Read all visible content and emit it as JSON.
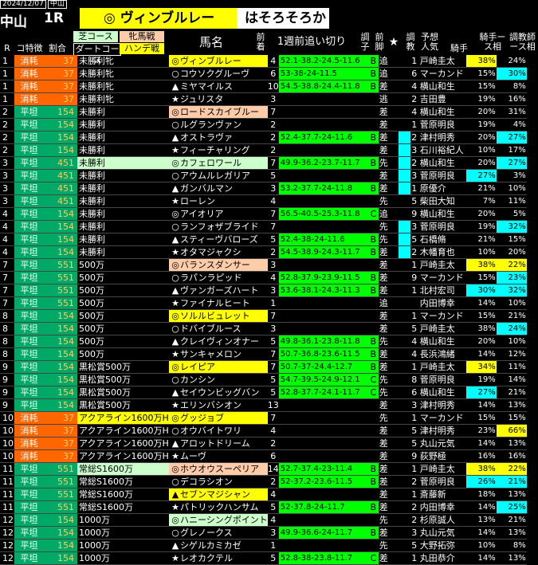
{
  "header": {
    "date": "2024/12/07",
    "venue_small": "中山",
    "venue": "中山",
    "race": "1R",
    "pick_mark": "◎",
    "pick_name": "ヴィンブルレー",
    "comment": "はそろそろか"
  },
  "columns": {
    "r": "R",
    "koku": "コ特徴",
    "wari": "割合",
    "cond_top": "芝コース",
    "cond_bottom": "ダートコース",
    "sexage": "牝馬戦",
    "handicap": "ハンデ戦",
    "horse": "馬名",
    "popularity": "前着",
    "training": "1週前追い切り",
    "grade": "調子",
    "leg": "前脚",
    "star": "★",
    "trainer_rank": "調教",
    "ninki": "予想人気",
    "jockey": "騎手",
    "jockey_rate": "騎手ース相",
    "trainer_rate": "調教師ース相"
  },
  "colors": {
    "shouhi": "#ff6600",
    "heitan": "#00aa66",
    "cond_green": "#ccffcc",
    "pick_pink": "#ffccaa",
    "yellow": "#ffff00",
    "cyan": "#00ffff",
    "pos_green": "#00ff00"
  },
  "rows": [
    {
      "r": "1",
      "k": "消耗",
      "w": "37",
      "c": "未勝利牝",
      "cc": "",
      "m": "◎",
      "h": "ヴィンブルレー",
      "hc": "yellow",
      "p": "4",
      "t": "52.1-38.2-24.5-11.6",
      "g": "B",
      "l": "追",
      "s": "",
      "tk": "",
      "n": "1",
      "j": "戸崎圭太",
      "j1": "38%",
      "j1c": "yellow",
      "j2": "24%",
      "j2c": ""
    },
    {
      "r": "1",
      "k": "消耗",
      "w": "37",
      "c": "未勝利牝",
      "cc": "",
      "m": "○",
      "h": "コウソクグルーヴ",
      "hc": "",
      "p": "6",
      "t": "53-38-24-11.5",
      "g": "B",
      "l": "追",
      "s": "",
      "tk": "",
      "n": "6",
      "j": "マーカンド",
      "j1": "15%",
      "j1c": "",
      "j2": "30%",
      "j2c": "cyan"
    },
    {
      "r": "1",
      "k": "消耗",
      "w": "37",
      "c": "未勝利牝",
      "cc": "",
      "m": "▲",
      "h": "ミヤマイルス",
      "hc": "",
      "p": "10",
      "t": "54.5-38.8-24.4-11.8",
      "g": "B",
      "l": "差",
      "s": "",
      "tk": "",
      "n": "4",
      "j": "横山和生",
      "j1": "15%",
      "j1c": "",
      "j2": "8%",
      "j2c": ""
    },
    {
      "r": "1",
      "k": "消耗",
      "w": "37",
      "c": "未勝利牝",
      "cc": "",
      "m": "★",
      "h": "ジュリスタ",
      "hc": "",
      "p": "3",
      "t": "",
      "g": "",
      "l": "逃",
      "s": "",
      "tk": "",
      "n": "2",
      "j": "吉田豊",
      "j1": "19%",
      "j1c": "",
      "j2": "16%",
      "j2c": ""
    },
    {
      "r": "2",
      "k": "平坦",
      "w": "154",
      "c": "未勝利",
      "cc": "",
      "m": "◎",
      "h": "ロードスカイブルー",
      "hc": "pink",
      "p": "7",
      "t": "",
      "g": "",
      "l": "差",
      "s": "",
      "tk": "",
      "n": "4",
      "j": "横山和生",
      "j1": "20%",
      "j1c": "",
      "j2": "31%",
      "j2c": ""
    },
    {
      "r": "2",
      "k": "平坦",
      "w": "154",
      "c": "未勝利",
      "cc": "",
      "m": "○",
      "h": "ルグランヴァン",
      "hc": "",
      "p": "2",
      "t": "",
      "g": "",
      "l": "差",
      "s": "",
      "tk": "",
      "n": "1",
      "j": "菅原明良",
      "j1": "19%",
      "j1c": "",
      "j2": "4%",
      "j2c": ""
    },
    {
      "r": "2",
      "k": "平坦",
      "w": "154",
      "c": "未勝利",
      "cc": "",
      "m": "▲",
      "h": "オストラヴァ",
      "hc": "",
      "p": "2",
      "t": "52.4-37.7-24-11.6",
      "g": "B",
      "l": "差",
      "s": "",
      "tk": "c",
      "n": "2",
      "j": "津村明秀",
      "j1": "20%",
      "j1c": "",
      "j2": "27%",
      "j2c": "cyan"
    },
    {
      "r": "2",
      "k": "平坦",
      "w": "154",
      "c": "未勝利",
      "cc": "",
      "m": "★",
      "h": "フィーチャリング",
      "hc": "",
      "p": "2",
      "t": "",
      "g": "",
      "l": "差",
      "s": "",
      "tk": "c",
      "n": "3",
      "j": "石川裕紀人",
      "j1": "10%",
      "j1c": "",
      "j2": "17%",
      "j2c": ""
    },
    {
      "r": "3",
      "k": "平坦",
      "w": "451",
      "c": "未勝利",
      "cc": "green",
      "m": "◎",
      "h": "カフェロワール",
      "hc": "green",
      "p": "7",
      "t": "49.9-36.2-23.7-11.7",
      "g": "B",
      "l": "先",
      "s": "",
      "tk": "c",
      "n": "2",
      "j": "横山和生",
      "j1": "20%",
      "j1c": "",
      "j2": "27%",
      "j2c": "cyan"
    },
    {
      "r": "3",
      "k": "平坦",
      "w": "451",
      "c": "未勝利",
      "cc": "",
      "m": "○",
      "h": "アウムルレガリア",
      "hc": "",
      "p": "5",
      "t": "",
      "g": "",
      "l": "差",
      "s": "",
      "tk": "c",
      "n": "3",
      "j": "菅原明良",
      "j1": "27%",
      "j1c": "cyan",
      "j2": "3%",
      "j2c": ""
    },
    {
      "r": "3",
      "k": "平坦",
      "w": "451",
      "c": "未勝利",
      "cc": "",
      "m": "▲",
      "h": "ガンバルマン",
      "hc": "",
      "p": "3",
      "t": "53.2-37.7-24-11.8",
      "g": "B",
      "l": "差",
      "s": "",
      "tk": "c",
      "n": "1",
      "j": "原優介",
      "j1": "21%",
      "j1c": "",
      "j2": "10%",
      "j2c": ""
    },
    {
      "r": "3",
      "k": "平坦",
      "w": "451",
      "c": "未勝利",
      "cc": "",
      "m": "★",
      "h": "ローレン",
      "hc": "",
      "p": "4",
      "t": "",
      "g": "",
      "l": "先",
      "s": "",
      "tk": "",
      "n": "5",
      "j": "柴田大知",
      "j1": "7%",
      "j1c": "",
      "j2": "11%",
      "j2c": ""
    },
    {
      "r": "4",
      "k": "平坦",
      "w": "154",
      "c": "未勝利",
      "cc": "",
      "m": "◎",
      "h": "アイオリア",
      "hc": "",
      "p": "7",
      "t": "56.5-40.5-25.3-11.8",
      "g": "C",
      "l": "追",
      "s": "",
      "tk": "",
      "n": "9",
      "j": "横山和生",
      "j1": "20%",
      "j1c": "",
      "j2": "5%",
      "j2c": ""
    },
    {
      "r": "4",
      "k": "平坦",
      "w": "154",
      "c": "未勝利",
      "cc": "",
      "m": "○",
      "h": "ランフォザブライド",
      "hc": "",
      "p": "7",
      "t": "",
      "g": "",
      "l": "先",
      "s": "",
      "tk": "c",
      "n": "3",
      "j": "菅原明良",
      "j1": "19%",
      "j1c": "",
      "j2": "32%",
      "j2c": "cyan"
    },
    {
      "r": "4",
      "k": "平坦",
      "w": "154",
      "c": "未勝利",
      "cc": "",
      "m": "▲",
      "h": "スティーヴバローズ",
      "hc": "",
      "p": "5",
      "t": "52.4-38-24-11.6",
      "g": "B",
      "l": "先",
      "s": "",
      "tk": "c",
      "n": "5",
      "j": "石橋脩",
      "j1": "21%",
      "j1c": "",
      "j2": "15%",
      "j2c": ""
    },
    {
      "r": "4",
      "k": "平坦",
      "w": "154",
      "c": "未勝利",
      "cc": "",
      "m": "★",
      "h": "オタマジャクシ",
      "hc": "",
      "p": "2",
      "t": "54.5-38.9-24.3-11.7",
      "g": "B",
      "l": "差",
      "s": "",
      "tk": "c",
      "n": "2",
      "j": "木幡育也",
      "j1": "10%",
      "j1c": "",
      "j2": "20%",
      "j2c": ""
    },
    {
      "r": "7",
      "k": "平坦",
      "w": "551",
      "c": "500万",
      "cc": "",
      "m": "◎",
      "h": "バランスダンサー",
      "hc": "pink",
      "p": "3",
      "t": "",
      "g": "",
      "l": "差",
      "s": "",
      "tk": "",
      "n": "1",
      "j": "戸崎圭太",
      "j1": "38%",
      "j1c": "yellow",
      "j2": "22%",
      "j2c": "yellow"
    },
    {
      "r": "7",
      "k": "平坦",
      "w": "551",
      "c": "500万",
      "cc": "",
      "m": "○",
      "h": "ラパンラピッド",
      "hc": "",
      "p": "4",
      "t": "52.8-37.9-23.9-11.5",
      "g": "B",
      "l": "差",
      "s": "",
      "tk": "",
      "n": "9",
      "j": "マーカンド",
      "j1": "15%",
      "j1c": "",
      "j2": "23%",
      "j2c": "cyan"
    },
    {
      "r": "7",
      "k": "平坦",
      "w": "551",
      "c": "500万",
      "cc": "",
      "m": "▲",
      "h": "ヴァンガーズハート",
      "hc": "",
      "p": "3",
      "t": "53.6-38.1-24.3-11.3",
      "g": "B",
      "l": "差",
      "s": "",
      "tk": "",
      "n": "1",
      "j": "北村宏司",
      "j1": "30%",
      "j1c": "cyan",
      "j2": "32%",
      "j2c": "cyan"
    },
    {
      "r": "7",
      "k": "平坦",
      "w": "551",
      "c": "500万",
      "cc": "",
      "m": "★",
      "h": "ファイナルヒート",
      "hc": "",
      "p": "1",
      "t": "",
      "g": "",
      "l": "追",
      "s": "",
      "tk": "",
      "n": "",
      "j": "内田博幸",
      "j1": "14%",
      "j1c": "",
      "j2": "10%",
      "j2c": ""
    },
    {
      "r": "8",
      "k": "平坦",
      "w": "154",
      "c": "500万",
      "cc": "",
      "m": "◎",
      "h": "ソルルビュレット",
      "hc": "yellow",
      "p": "7",
      "t": "",
      "g": "",
      "l": "差",
      "s": "",
      "tk": "",
      "n": "1",
      "j": "マーカンド",
      "j1": "15%",
      "j1c": "",
      "j2": "21%",
      "j2c": ""
    },
    {
      "r": "8",
      "k": "平坦",
      "w": "154",
      "c": "500万",
      "cc": "",
      "m": "○",
      "h": "ドバイブルース",
      "hc": "",
      "p": "3",
      "t": "",
      "g": "",
      "l": "差",
      "s": "",
      "tk": "",
      "n": "5",
      "j": "戸崎圭太",
      "j1": "38%",
      "j1c": "",
      "j2": "24%",
      "j2c": "cyan"
    },
    {
      "r": "8",
      "k": "平坦",
      "w": "154",
      "c": "500万",
      "cc": "",
      "m": "▲",
      "h": "クレイヴィンオナー",
      "hc": "",
      "p": "5",
      "t": "49.8-36.1-23.8-11.8",
      "g": "B",
      "l": "先",
      "s": "",
      "tk": "",
      "n": "4",
      "j": "横山和生",
      "j1": "20%",
      "j1c": "",
      "j2": "10%",
      "j2c": ""
    },
    {
      "r": "8",
      "k": "平坦",
      "w": "154",
      "c": "500万",
      "cc": "",
      "m": "★",
      "h": "サンキャメロン",
      "hc": "",
      "p": "7",
      "t": "50.7-36.8-23.6-11.5",
      "g": "B",
      "l": "差",
      "s": "",
      "tk": "",
      "n": "4",
      "j": "長浜鴻緒",
      "j1": "14%",
      "j1c": "",
      "j2": "12%",
      "j2c": ""
    },
    {
      "r": "9",
      "k": "平坦",
      "w": "154",
      "c": "黒松賞500万",
      "cc": "",
      "m": "◎",
      "h": "レイピア",
      "hc": "yellow",
      "p": "7",
      "t": "50.7-37-24.4-12.7",
      "g": "B",
      "l": "差",
      "s": "",
      "tk": "",
      "n": "1",
      "j": "戸崎圭太",
      "j1": "34%",
      "j1c": "yellow",
      "j2": "11%",
      "j2c": ""
    },
    {
      "r": "9",
      "k": "平坦",
      "w": "154",
      "c": "黒松賞500万",
      "cc": "",
      "m": "○",
      "h": "カンシン",
      "hc": "",
      "p": "5",
      "t": "54.7-39.5-24.9-12.1",
      "g": "C",
      "l": "先",
      "s": "",
      "tk": "",
      "n": "8",
      "j": "菅原明良",
      "j1": "19%",
      "j1c": "",
      "j2": "14%",
      "j2c": ""
    },
    {
      "r": "9",
      "k": "平坦",
      "w": "154",
      "c": "黒松賞500万",
      "cc": "",
      "m": "▲",
      "h": "セイウンビッグバン",
      "hc": "",
      "p": "5",
      "t": "52.8-37.7-24.1-11.7",
      "g": "C",
      "l": "先",
      "s": "",
      "tk": "",
      "n": "6",
      "j": "横山和生",
      "j1": "27%",
      "j1c": "cyan",
      "j2": "21%",
      "j2c": ""
    },
    {
      "r": "9",
      "k": "平坦",
      "w": "154",
      "c": "黒松賞500万",
      "cc": "",
      "m": "★",
      "h": "エリンバシオン",
      "hc": "",
      "p": "13",
      "t": "",
      "g": "",
      "l": "差",
      "s": "",
      "tk": "",
      "n": "3",
      "j": "津村明秀",
      "j1": "14%",
      "j1c": "",
      "j2": "13%",
      "j2c": ""
    },
    {
      "r": "10",
      "k": "消耗",
      "w": "37",
      "c": "アクアライン1600万H",
      "cc": "yellow",
      "m": "◎",
      "h": "グッジョブ",
      "hc": "yellow",
      "p": "7",
      "t": "",
      "g": "",
      "l": "先",
      "s": "",
      "tk": "",
      "n": "1",
      "j": "マーカンド",
      "j1": "15%",
      "j1c": "",
      "j2": "15%",
      "j2c": ""
    },
    {
      "r": "10",
      "k": "消耗",
      "w": "37",
      "c": "アクアライン1600万H",
      "cc": "",
      "m": "○",
      "h": "オウバイトワリ",
      "hc": "",
      "p": "4",
      "t": "",
      "g": "",
      "l": "差",
      "s": "",
      "tk": "",
      "n": "5",
      "j": "津村明秀",
      "j1": "23%",
      "j1c": "",
      "j2": "66%",
      "j2c": "yellow"
    },
    {
      "r": "10",
      "k": "消耗",
      "w": "37",
      "c": "アクアライン1600万H",
      "cc": "",
      "m": "▲",
      "h": "アロットドリーム",
      "hc": "",
      "p": "2",
      "t": "",
      "g": "",
      "l": "差",
      "s": "",
      "tk": "",
      "n": "5",
      "j": "丸山元気",
      "j1": "14%",
      "j1c": "",
      "j2": "13%",
      "j2c": ""
    },
    {
      "r": "10",
      "k": "消耗",
      "w": "37",
      "c": "アクアライン1600万H",
      "cc": "",
      "m": "★",
      "h": "ムーヴ",
      "hc": "",
      "p": "6",
      "t": "",
      "g": "",
      "l": "差",
      "s": "",
      "tk": "",
      "n": "9",
      "j": "荻野極",
      "j1": "16%",
      "j1c": "",
      "j2": "16%",
      "j2c": ""
    },
    {
      "r": "11",
      "k": "平坦",
      "w": "551",
      "c": "常総S1600万",
      "cc": "green",
      "m": "◎",
      "h": "ホウオウスーペリア",
      "hc": "pink",
      "p": "14",
      "t": "52.7-37.4-23-11.4",
      "g": "B",
      "l": "差",
      "s": "",
      "tk": "",
      "n": "1",
      "j": "戸崎圭太",
      "j1": "38%",
      "j1c": "yellow",
      "j2": "22%",
      "j2c": "yellow"
    },
    {
      "r": "11",
      "k": "平坦",
      "w": "551",
      "c": "常総S1600万",
      "cc": "",
      "m": "○",
      "h": "デコラシオン",
      "hc": "",
      "p": "2",
      "t": "52-37.2-23.6-11.5",
      "g": "B",
      "l": "差",
      "s": "",
      "tk": "",
      "n": "2",
      "j": "菅原明良",
      "j1": "26%",
      "j1c": "cyan",
      "j2": "21%",
      "j2c": "cyan"
    },
    {
      "r": "11",
      "k": "平坦",
      "w": "551",
      "c": "常総S1600万",
      "cc": "",
      "m": "▲",
      "h": "セブンマジシャン",
      "hc": "yellow",
      "p": "4",
      "t": "",
      "g": "",
      "l": "差",
      "s": "",
      "tk": "",
      "n": "1",
      "j": "斎藤新",
      "j1": "18%",
      "j1c": "",
      "j2": "13%",
      "j2c": ""
    },
    {
      "r": "11",
      "k": "平坦",
      "w": "551",
      "c": "常総S1600万",
      "cc": "",
      "m": "★",
      "h": "パトリックハンサム",
      "hc": "",
      "p": "5",
      "t": "52-37.8-24-11.7",
      "g": "B",
      "l": "差",
      "s": "",
      "tk": "",
      "n": "2",
      "j": "内田博幸",
      "j1": "14%",
      "j1c": "",
      "j2": "25%",
      "j2c": "cyan"
    },
    {
      "r": "12",
      "k": "平坦",
      "w": "154",
      "c": "1000万",
      "cc": "",
      "m": "◎",
      "h": "ハニーシングポイント",
      "hc": "green",
      "p": "4",
      "t": "",
      "g": "",
      "l": "先",
      "s": "",
      "tk": "",
      "n": "2",
      "j": "杉原誠人",
      "j1": "13%",
      "j1c": "",
      "j2": "21%",
      "j2c": ""
    },
    {
      "r": "12",
      "k": "平坦",
      "w": "154",
      "c": "1000万",
      "cc": "",
      "m": "○",
      "h": "グレノークス",
      "hc": "",
      "p": "3",
      "t": "49.9-36.6-24-11.7",
      "g": "B",
      "l": "差",
      "s": "",
      "tk": "",
      "n": "3",
      "j": "丸山元気",
      "j1": "14%",
      "j1c": "",
      "j2": "13%",
      "j2c": ""
    },
    {
      "r": "12",
      "k": "平坦",
      "w": "154",
      "c": "1000万",
      "cc": "",
      "m": "▲",
      "h": "シゲルカミカゼ",
      "hc": "",
      "p": "1",
      "t": "",
      "g": "",
      "l": "先",
      "s": "",
      "tk": "",
      "n": "5",
      "j": "大野拓弥",
      "j1": "10%",
      "j1c": "",
      "j2": "8%",
      "j2c": ""
    },
    {
      "r": "12",
      "k": "平坦",
      "w": "154",
      "c": "1000万",
      "cc": "",
      "m": "★",
      "h": "レオカクテル",
      "hc": "",
      "p": "5",
      "t": "52.8-38-23.8-11.7",
      "g": "C",
      "l": "差",
      "s": "",
      "tk": "",
      "n": "1",
      "j": "丸田恭介",
      "j1": "14%",
      "j1c": "",
      "j2": "13%",
      "j2c": ""
    }
  ]
}
